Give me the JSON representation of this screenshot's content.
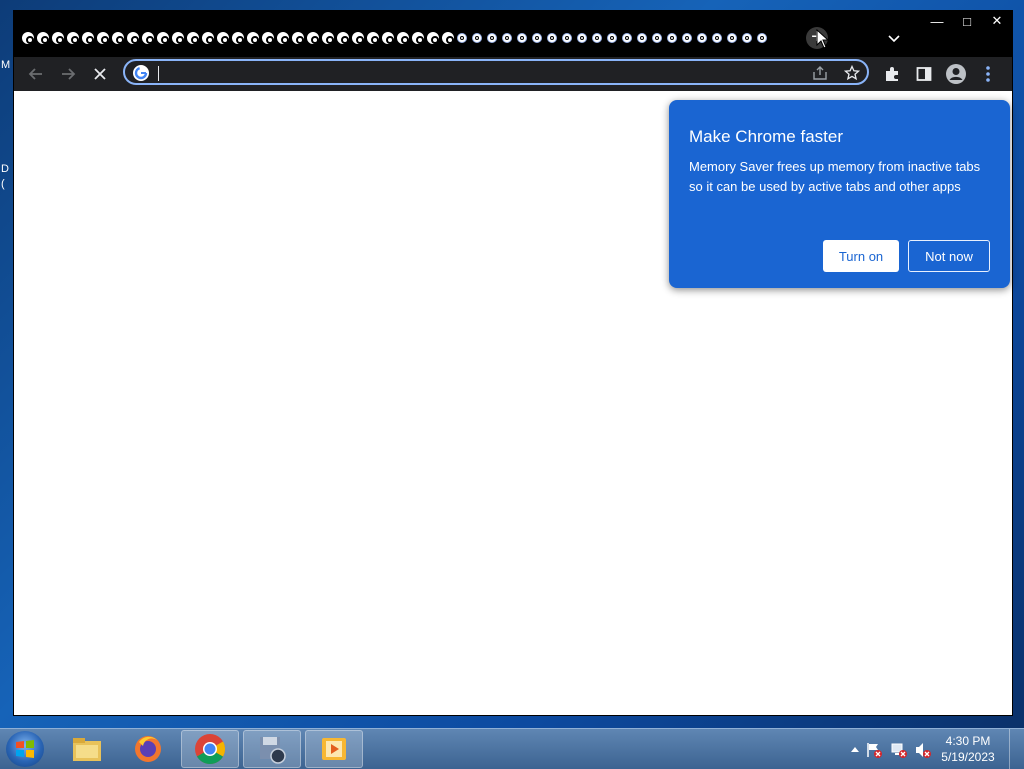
{
  "desktop": {
    "fragment_1": "M",
    "fragment_2": "D",
    "fragment_3": "("
  },
  "browser": {
    "tabs": {
      "full_count": 29,
      "small_count": 21
    },
    "new_tab_label": "+",
    "tab_search_icon": "chevron-down-icon",
    "window_controls": {
      "minimize": "—",
      "maximize": "□",
      "close": "✕"
    },
    "toolbar": {
      "back_icon": "arrow-left-icon",
      "forward_icon": "arrow-right-icon",
      "stop_icon": "close-icon",
      "omnibox_value": "",
      "share_icon": "share-icon",
      "bookmark_icon": "star-icon",
      "extensions_icon": "puzzle-icon",
      "side_panel_icon": "side-panel-icon",
      "profile_icon": "avatar-icon",
      "menu_icon": "kebab-menu-icon"
    }
  },
  "popup": {
    "title": "Make Chrome faster",
    "body": "Memory Saver frees up memory from inactive tabs so it can be used by active tabs and other apps",
    "turn_on_label": "Turn on",
    "not_now_label": "Not now"
  },
  "taskbar": {
    "apps": [
      "windows-explorer",
      "firefox",
      "chrome",
      "media-tool",
      "media-player"
    ],
    "clock": {
      "time": "4:30 PM",
      "date": "5/19/2023"
    }
  },
  "colors": {
    "accent": "#1a65d2",
    "toolbar": "#202124",
    "omnibox_border": "#8ab4f8"
  }
}
